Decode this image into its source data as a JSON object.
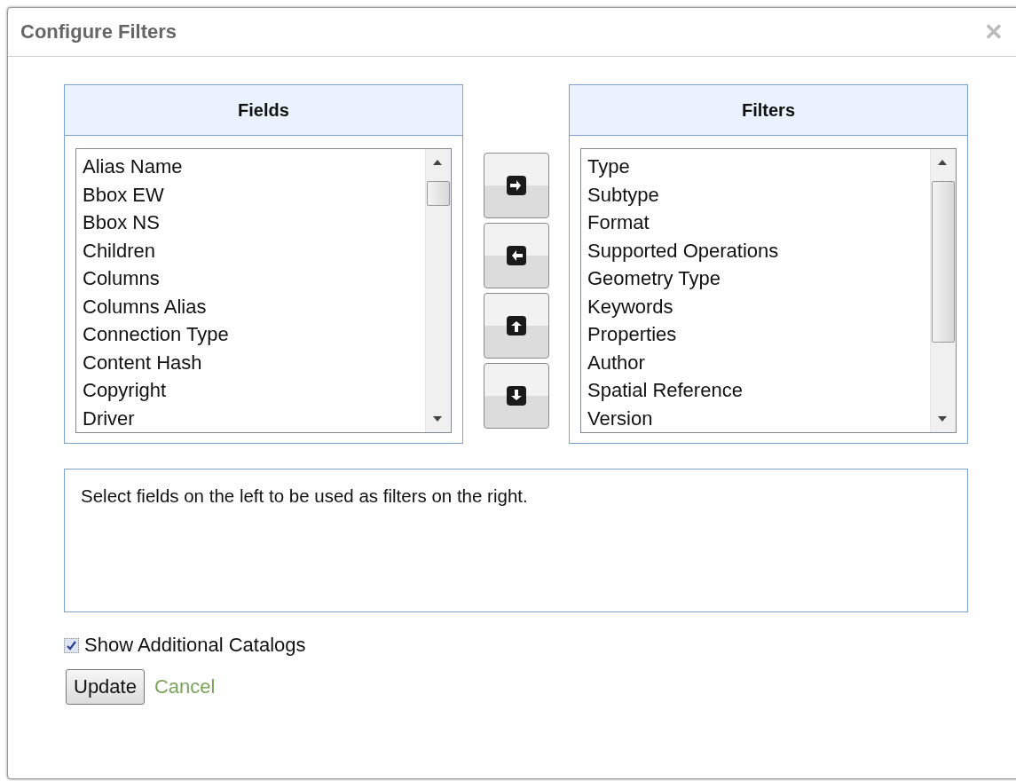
{
  "dialog": {
    "title": "Configure Filters",
    "close_symbol": "✕"
  },
  "fields": {
    "heading": "Fields",
    "items": [
      "Alias Name",
      "Bbox EW",
      "Bbox NS",
      "Children",
      "Columns",
      "Columns Alias",
      "Connection Type",
      "Content Hash",
      "Copyright",
      "Driver"
    ]
  },
  "move_buttons": [
    {
      "kind": "right"
    },
    {
      "kind": "left"
    },
    {
      "kind": "up"
    },
    {
      "kind": "down"
    }
  ],
  "filters": {
    "heading": "Filters",
    "items": [
      "Type",
      "Subtype",
      "Format",
      "Supported Operations",
      "Geometry Type",
      "Keywords",
      "Properties",
      "Author",
      "Spatial Reference",
      "Version"
    ]
  },
  "description": "Select fields on the left to be used as filters on the right.",
  "show_additional_catalogs": {
    "label": "Show Additional Catalogs",
    "checked": true
  },
  "buttons": {
    "update": "Update",
    "cancel": "Cancel"
  }
}
